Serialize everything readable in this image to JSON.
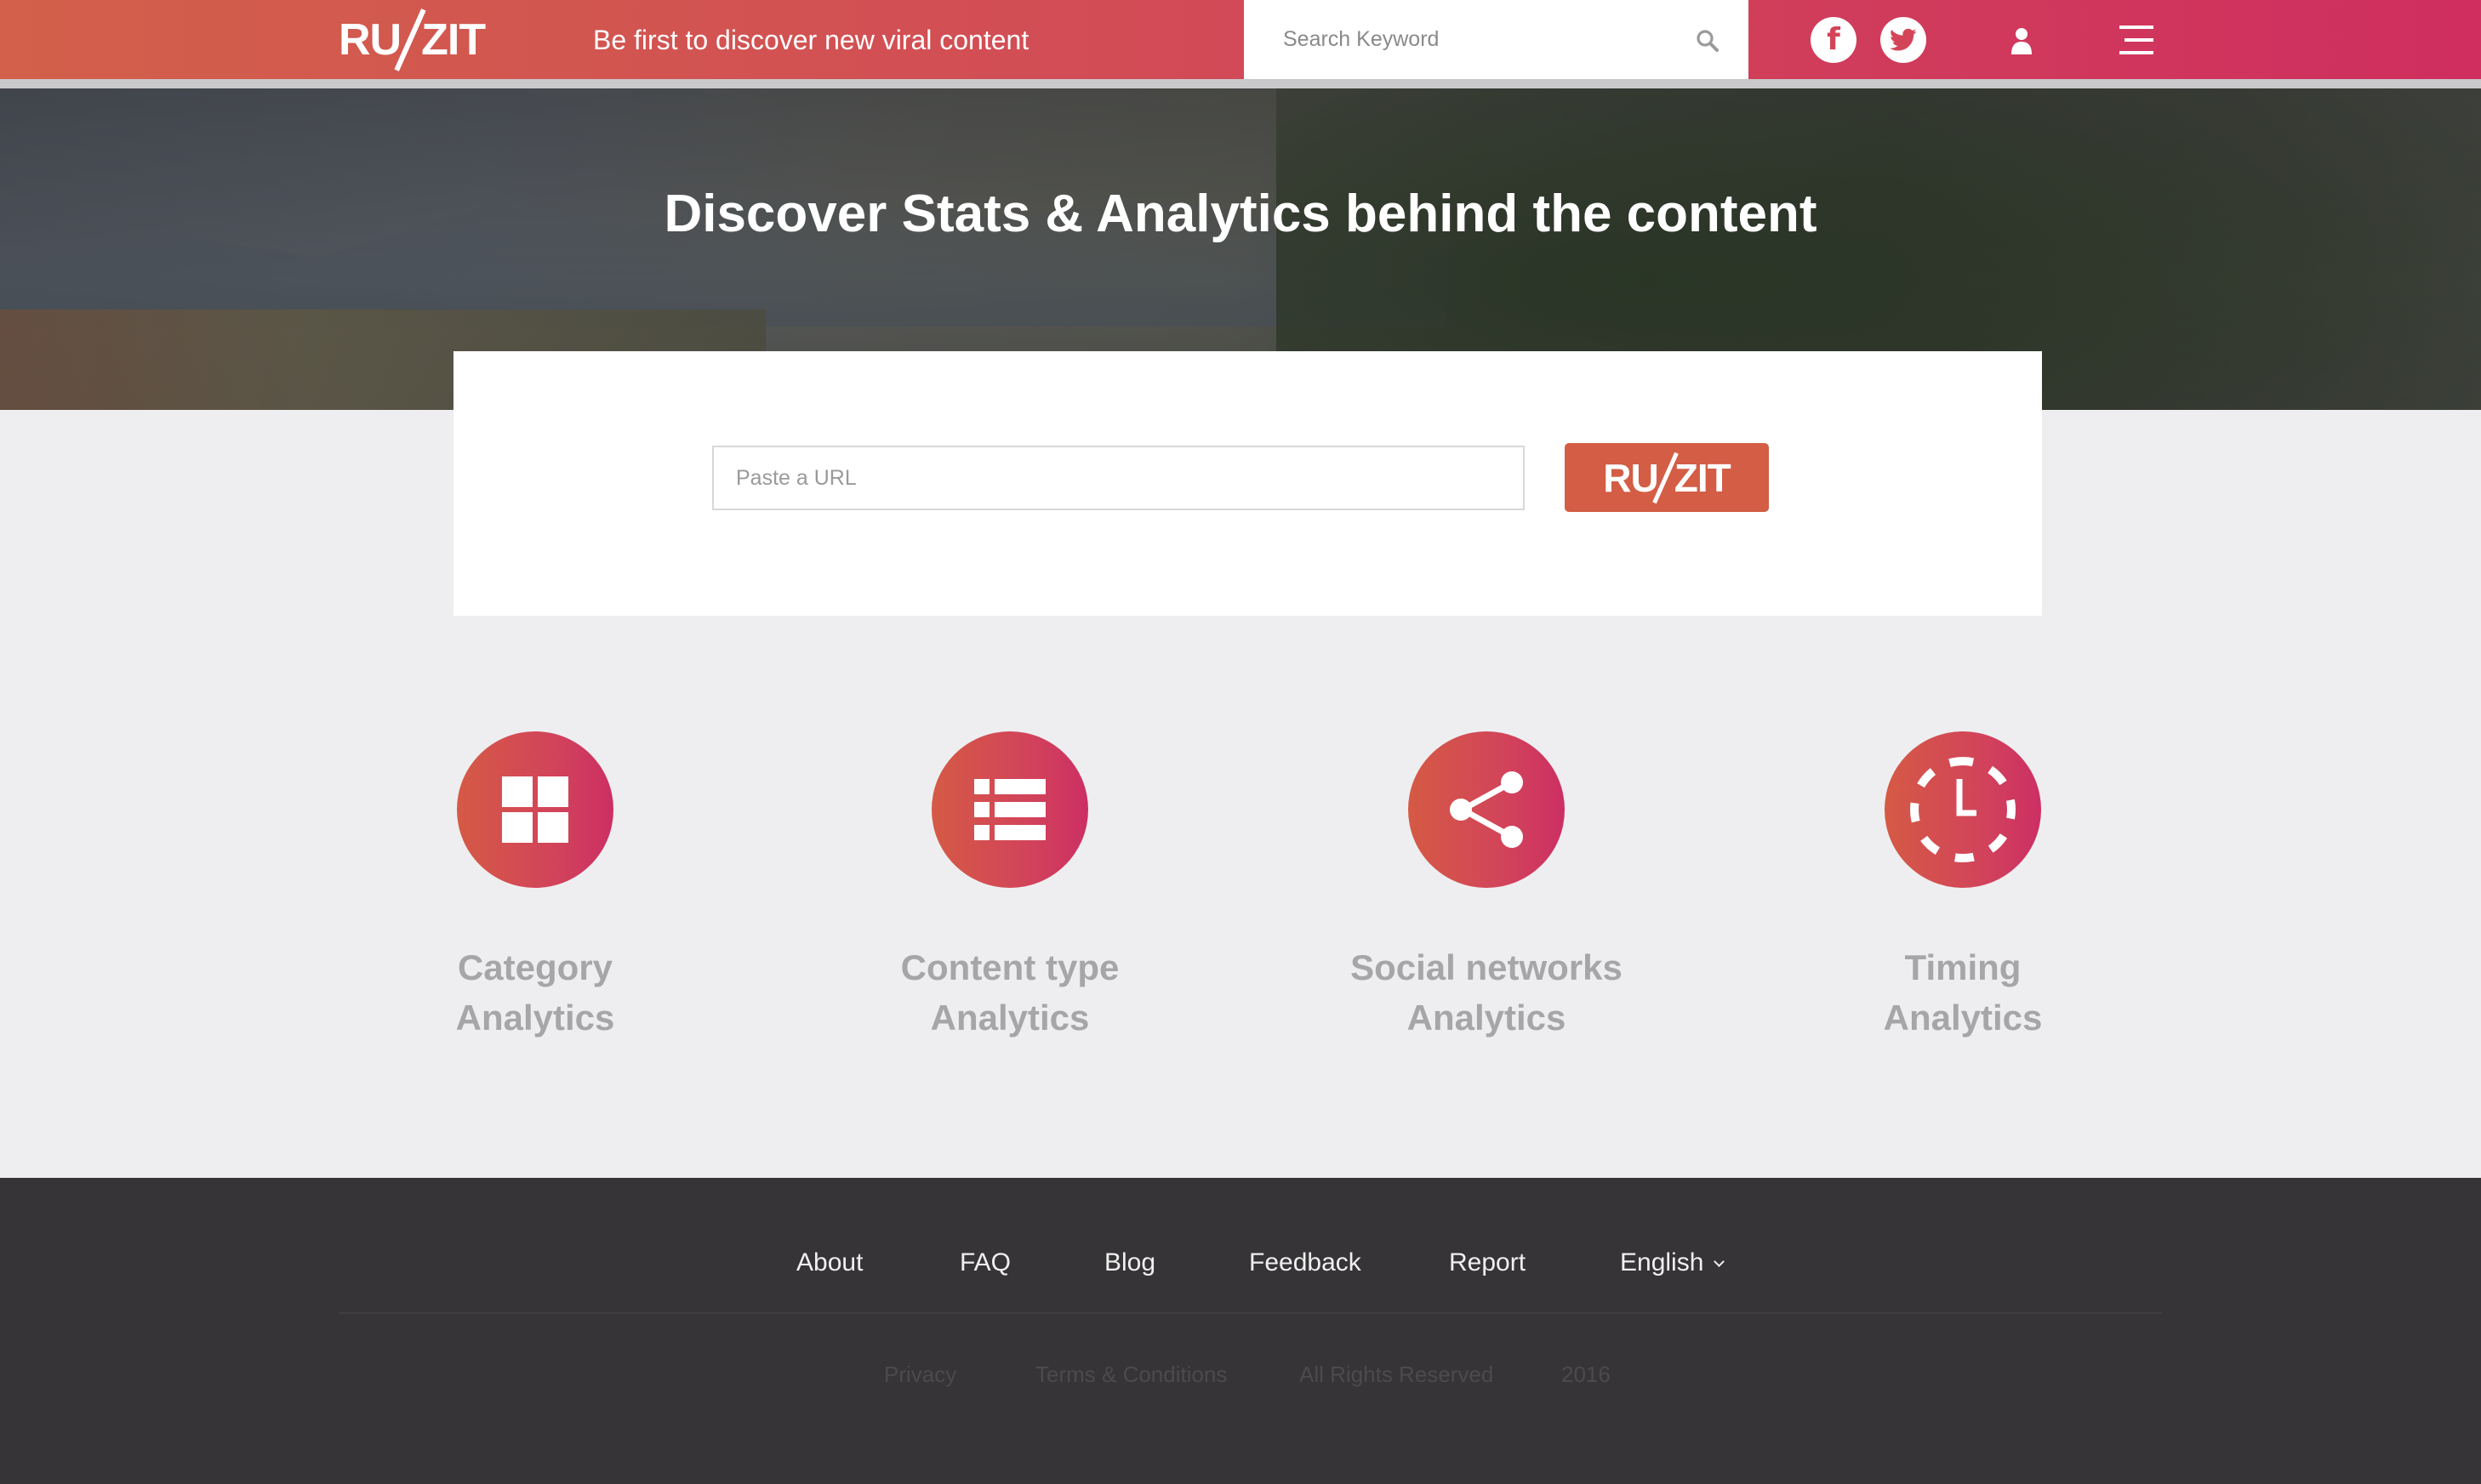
{
  "header": {
    "logo_text_left": "RU",
    "logo_text_right": "ZIT",
    "tagline": "Be first to discover new viral content",
    "search_placeholder": "Search Keyword",
    "facebook_letter": "f",
    "icons": [
      "search-icon",
      "facebook-icon",
      "twitter-icon",
      "user-icon",
      "hamburger-menu-icon"
    ]
  },
  "hero": {
    "title": "Discover Stats & Analytics behind the content"
  },
  "url_form": {
    "placeholder": "Paste a URL",
    "button_text_left": "RU",
    "button_text_right": "ZIT"
  },
  "features": [
    {
      "line1": "Category",
      "line2": "Analytics",
      "icon": "grid-icon"
    },
    {
      "line1": "Content type",
      "line2": "Analytics",
      "icon": "list-icon"
    },
    {
      "line1": "Social networks",
      "line2": "Analytics",
      "icon": "share-icon"
    },
    {
      "line1": "Timing",
      "line2": "Analytics",
      "icon": "clock-icon"
    }
  ],
  "footer": {
    "nav": [
      "About",
      "FAQ",
      "Blog",
      "Feedback",
      "Report"
    ],
    "language": "English",
    "legal": [
      "Privacy",
      "Terms & Conditions",
      "All Rights Reserved",
      "2016"
    ]
  },
  "colors": {
    "brand_gradient_start": "#d2604a",
    "brand_gradient_end": "#cf2e5f",
    "button": "#d35d45",
    "footer_bg": "#363436",
    "page_bg": "#eeeef0"
  }
}
